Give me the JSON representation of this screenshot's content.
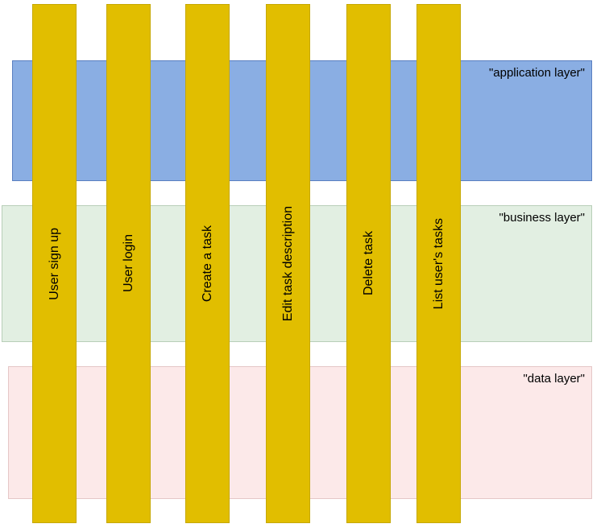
{
  "layers": [
    {
      "id": "application",
      "label": "\"application layer\""
    },
    {
      "id": "business",
      "label": "\"business layer\""
    },
    {
      "id": "data",
      "label": "\"data layer\""
    }
  ],
  "slices": [
    {
      "id": "user-sign-up",
      "label": "User sign up"
    },
    {
      "id": "user-login",
      "label": "User login"
    },
    {
      "id": "create-a-task",
      "label": "Create a task"
    },
    {
      "id": "edit-task-desc",
      "label": "Edit task description"
    },
    {
      "id": "delete-task",
      "label": "Delete task"
    },
    {
      "id": "list-users-tasks",
      "label": "List user's tasks"
    }
  ]
}
